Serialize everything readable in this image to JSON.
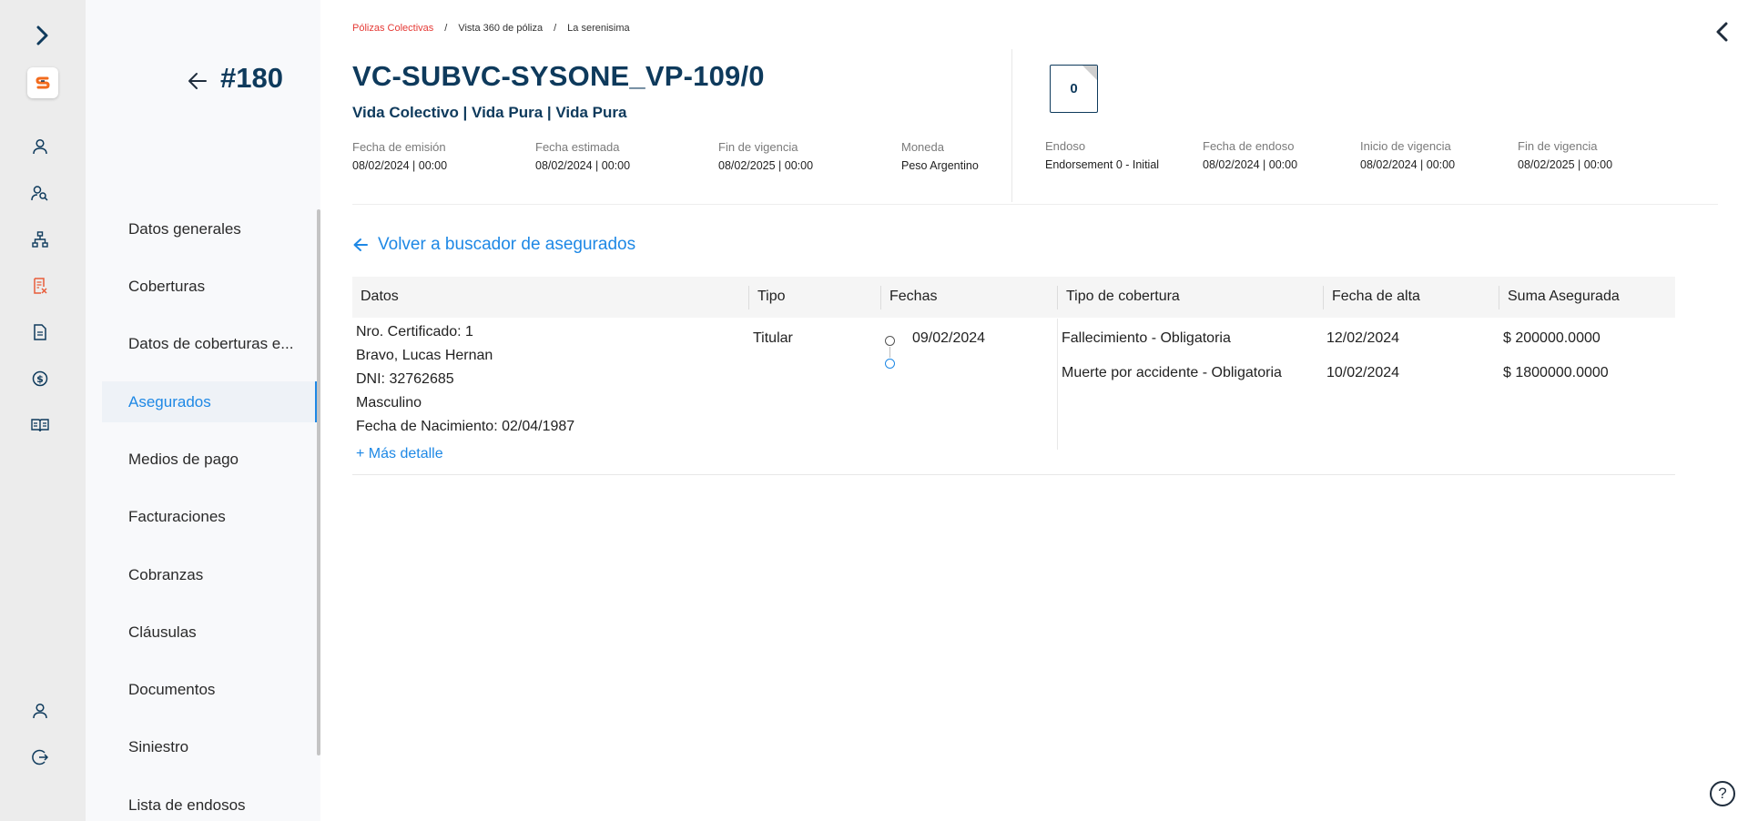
{
  "rail": {
    "icons": [
      "chevron-right-icon",
      "logo",
      "user-icon",
      "users-search-icon",
      "hierarchy-icon",
      "policy-doc-icon",
      "document-icon",
      "dollar-icon",
      "book-icon",
      "profile-icon",
      "logout-icon"
    ],
    "logo_letter": "S"
  },
  "nav": {
    "policy_number": "#180",
    "items": [
      {
        "label": "Datos generales"
      },
      {
        "label": "Coberturas"
      },
      {
        "label": "Datos de coberturas e..."
      },
      {
        "label": "Asegurados"
      },
      {
        "label": "Medios de pago"
      },
      {
        "label": "Facturaciones"
      },
      {
        "label": "Cobranzas"
      },
      {
        "label": "Cláusulas"
      },
      {
        "label": "Documentos"
      },
      {
        "label": "Siniestro"
      },
      {
        "label": "Lista de endosos"
      }
    ],
    "active_index": 3
  },
  "breadcrumb": {
    "items": [
      "Pólizas Colectivas",
      "Vista 360 de póliza",
      "La serenisima"
    ],
    "separator": "/"
  },
  "header": {
    "title": "VC-SUBVC-SYSONE_VP-109/0",
    "subtitle": "Vida Colectivo | Vida Pura | Vida Pura",
    "badge": "0",
    "meta_left": [
      {
        "label": "Fecha de emisión",
        "value": "08/02/2024 | 00:00"
      },
      {
        "label": "Fecha estimada",
        "value": "08/02/2024 | 00:00"
      },
      {
        "label": "Fin de vigencia",
        "value": "08/02/2025 | 00:00"
      },
      {
        "label": "Moneda",
        "value": "Peso Argentino"
      }
    ],
    "meta_right": [
      {
        "label": "Endoso",
        "value": "Endorsement 0 - Initial"
      },
      {
        "label": "Fecha de endoso",
        "value": "08/02/2024 | 00:00"
      },
      {
        "label": "Inicio de vigencia",
        "value": "08/02/2024 | 00:00"
      },
      {
        "label": "Fin de vigencia",
        "value": "08/02/2025 | 00:00"
      }
    ]
  },
  "back_link": "Volver a buscador de asegurados",
  "table": {
    "columns": [
      "Datos",
      "Tipo",
      "Fechas",
      "Tipo de cobertura",
      "Fecha de alta",
      "Suma Asegurada"
    ],
    "row": {
      "datos": [
        "Nro. Certificado: 1",
        "Bravo, Lucas Hernan",
        "DNI: 32762685",
        "Masculino",
        "Fecha de Nacimiento: 02/04/1987"
      ],
      "more_detail": "+ Más detalle",
      "tipo": "Titular",
      "fechas": [
        "09/02/2024"
      ],
      "coberturas": [
        {
          "tipo": "Fallecimiento - Obligatoria",
          "fecha_alta": "12/02/2024",
          "suma": "$ 200000.0000"
        },
        {
          "tipo": "Muerte por accidente - Obligatoria",
          "fecha_alta": "10/02/2024",
          "suma": "$ 1800000.0000"
        }
      ]
    }
  },
  "colors": {
    "accent": "#1e88e5",
    "title": "#0e3a5c",
    "breadcrumb_active": "#e53935",
    "logo_orange": "#f26b1d"
  }
}
